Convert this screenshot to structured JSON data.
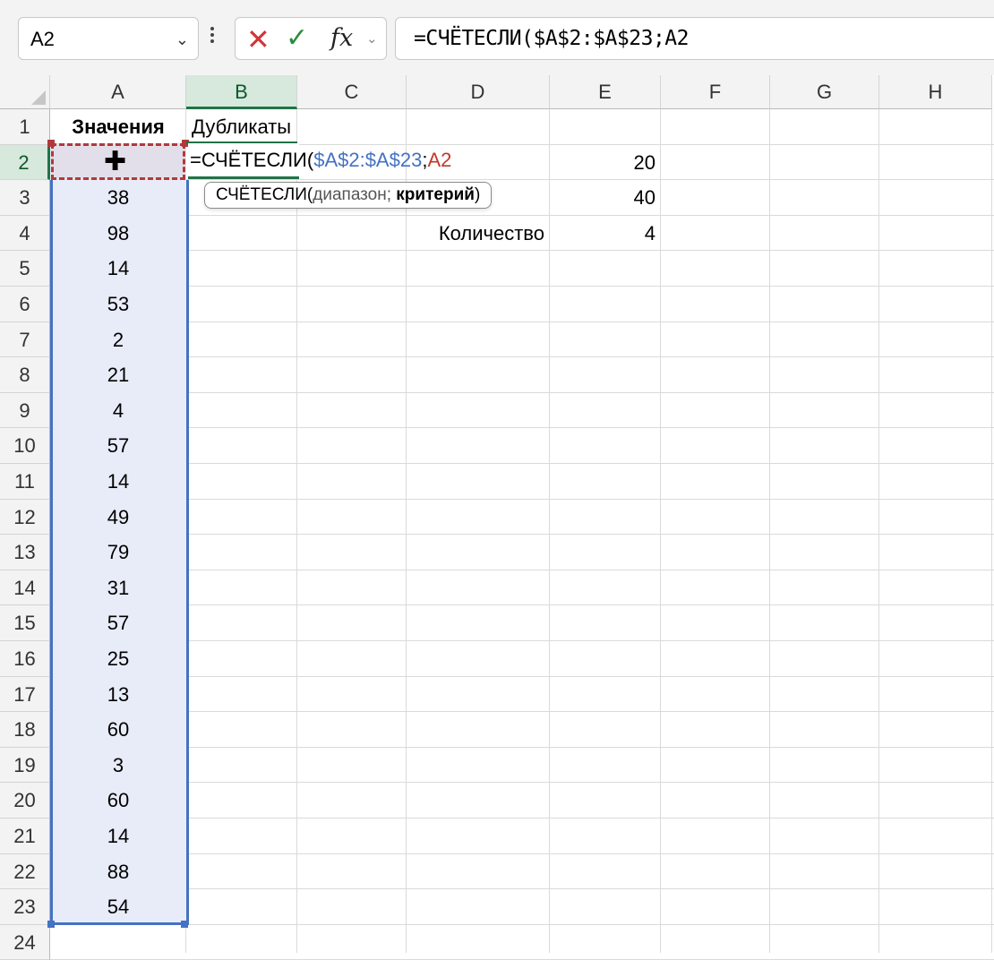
{
  "formula_bar": {
    "name_box": "A2",
    "name_box_chevron": "chevron-down-icon",
    "cancel_glyph": "✕",
    "enter_glyph": "✓",
    "fx_label": "fx",
    "formula_text": "=СЧЁТЕСЛИ($A$2:$A$23;A2"
  },
  "columns": [
    "A",
    "B",
    "C",
    "D",
    "E",
    "F",
    "G",
    "H"
  ],
  "selected_column": "B",
  "rows": [
    "1",
    "2",
    "3",
    "4",
    "5",
    "6",
    "7",
    "8",
    "9",
    "10",
    "11",
    "12",
    "13",
    "14",
    "15",
    "16",
    "17",
    "18",
    "19",
    "20",
    "21",
    "22",
    "23",
    "24"
  ],
  "selected_row": "2",
  "cells": {
    "A1": "Значения",
    "B1": "Дубликаты",
    "A3": "38",
    "A4": "98",
    "A5": "14",
    "A6": "53",
    "A7": "2",
    "A8": "21",
    "A9": "4",
    "A10": "57",
    "A11": "14",
    "A12": "49",
    "A13": "79",
    "A14": "31",
    "A15": "57",
    "A16": "25",
    "A17": "13",
    "A18": "60",
    "A19": "3",
    "A20": "60",
    "A21": "14",
    "A22": "88",
    "A23": "54",
    "D4": "Количество",
    "E2": "20",
    "E3": "40",
    "E4": "4"
  },
  "editing_cell": {
    "ref": "B2",
    "prefix": "=СЧЁТЕСЛИ(",
    "range_ref": "$A$2:$A$23",
    "separator": ";",
    "criteria_ref": "A2"
  },
  "tooltip": {
    "function": "СЧЁТЕСЛИ(",
    "arg1": "диапазон; ",
    "arg2": "критерий",
    "close": ")"
  },
  "colors": {
    "range_ref": "#4472c4",
    "criteria_ref": "#c0392b",
    "selection_green": "#217346"
  }
}
